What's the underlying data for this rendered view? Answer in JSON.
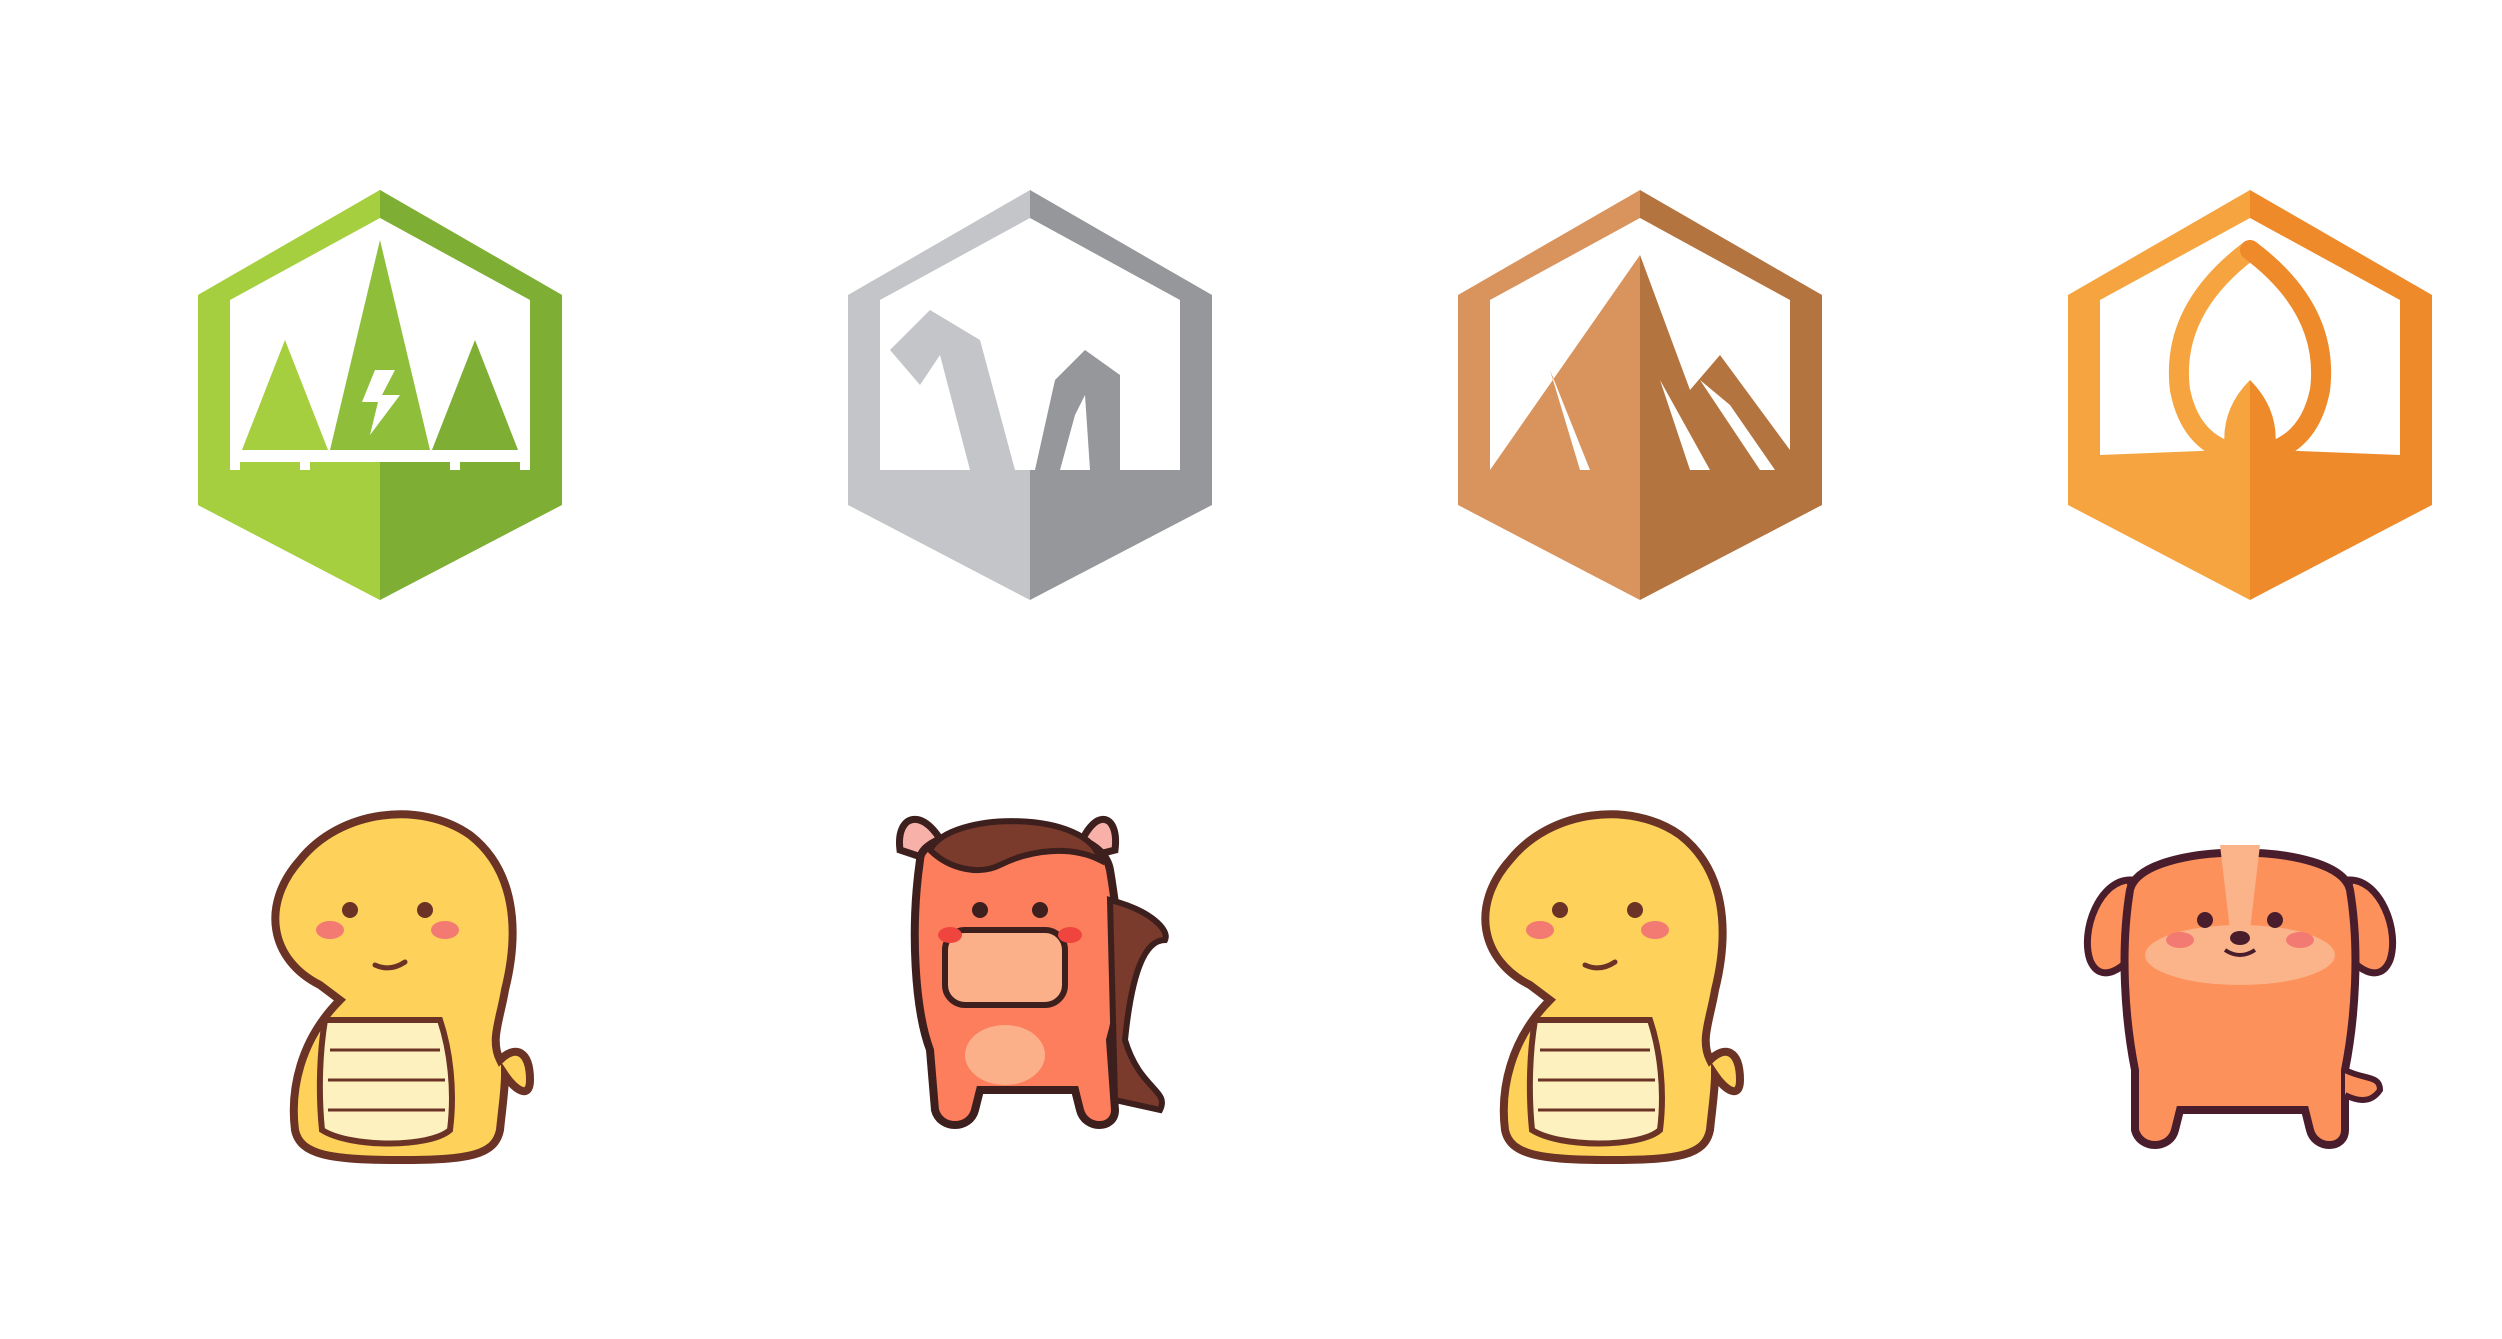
{
  "badges": [
    {
      "icon": "forest-badge-icon",
      "light": "#a6cf3f",
      "dark": "#7fae35"
    },
    {
      "icon": "rock-arch-badge-icon",
      "light": "#c4c5c8",
      "dark": "#96979b"
    },
    {
      "icon": "mountain-badge-icon",
      "light": "#d9935c",
      "dark": "#b4743f"
    },
    {
      "icon": "flame-badge-icon",
      "light": "#f5a440",
      "dark": "#ee8a2a"
    }
  ],
  "characters": [
    {
      "icon": "snake-character-icon",
      "body": "#fed15a",
      "belly": "#fdf2bf",
      "outline": "#6a3326"
    },
    {
      "icon": "horse-character-icon",
      "body": "#fc7e5d",
      "mane": "#7a3a2c",
      "outline": "#3d1f1e"
    },
    {
      "icon": "snake-character-icon",
      "body": "#fed15a",
      "belly": "#fdf2bf",
      "outline": "#6a3326"
    },
    {
      "icon": "dog-character-icon",
      "body": "#fd915c",
      "accent": "#fbb48a",
      "outline": "#4a1d2c"
    }
  ]
}
